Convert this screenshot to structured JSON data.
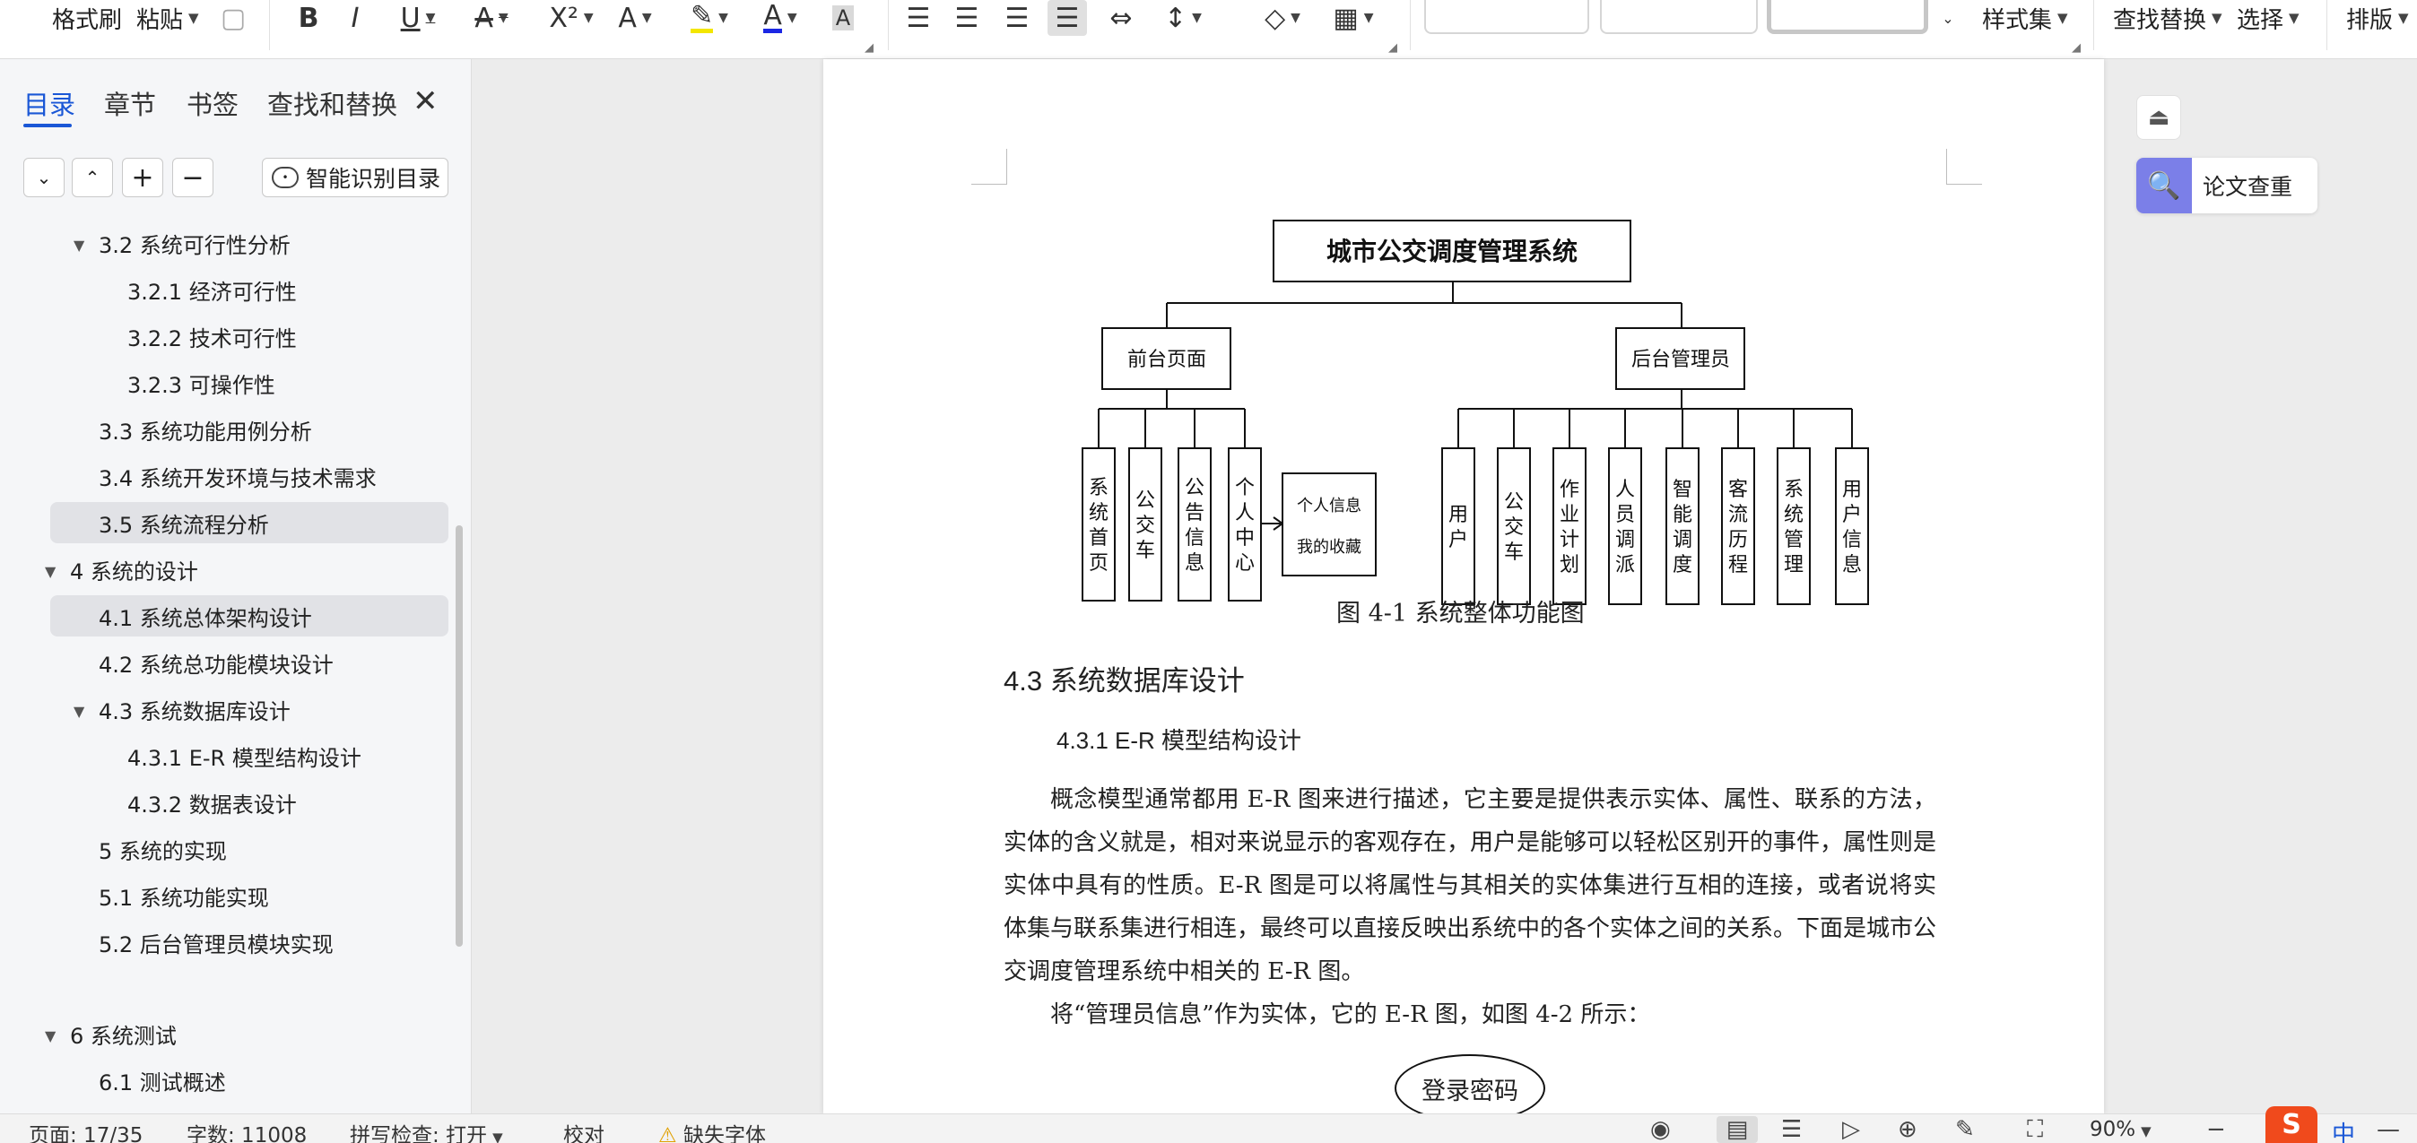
{
  "ribbon": {
    "format_painter": "格式刷",
    "paste": "粘贴",
    "style_set": "样式集",
    "find_replace": "查找替换",
    "select": "选择",
    "layout": "排版"
  },
  "nav": {
    "tabs": [
      "目录",
      "章节",
      "书签",
      "查找和替换"
    ],
    "smart_toc": "智能识别目录",
    "items": [
      {
        "label": "3.2  系统可行性分析"
      },
      {
        "label": "3.2.1 经济可行性"
      },
      {
        "label": "3.2.2 技术可行性"
      },
      {
        "label": "3.2.3 可操作性"
      },
      {
        "label": "3.3 系统功能用例分析"
      },
      {
        "label": "3.4 系统开发环境与技术需求"
      },
      {
        "label": "3.5 系统流程分析"
      },
      {
        "label": "4   系统的设计"
      },
      {
        "label": "4.1  系统总体架构设计"
      },
      {
        "label": "4.2  系统总功能模块设计"
      },
      {
        "label": "4.3 系统数据库设计"
      },
      {
        "label": "4.3.1 E-R 模型结构设计"
      },
      {
        "label": "4.3.2 数据表设计"
      },
      {
        "label": "5   系统的实现"
      },
      {
        "label": "5.1 系统功能实现"
      },
      {
        "label": "5.2 后台管理员模块实现"
      },
      {
        "label": "6 系统测试"
      },
      {
        "label": "6.1 测试概述"
      }
    ]
  },
  "diagram": {
    "root": "城市公交调度管理系统",
    "front": "前台页面",
    "back": "后台管理员",
    "front_children": [
      "系统首页",
      "公交车",
      "公告信息",
      "个人中心"
    ],
    "personal_box": [
      "个人信息",
      "我的收藏"
    ],
    "back_children": [
      "用户",
      "公交车",
      "作业计划",
      "人员调派",
      "智能调度",
      "客流历程",
      "系统管理",
      "用户信息"
    ]
  },
  "document": {
    "caption": "图 4-1  系统整体功能图",
    "heading_2": "4.3 系统数据库设计",
    "heading_3": "4.3.1  E-R 模型结构设计",
    "paragraph_1": "概念模型通常都用 E-R 图来进行描述，它主要是提供表示实体、属性、联系的方法，实体的含义就是，相对来说显示的客观存在，用户是能够可以轻松区别开的事件，属性则是实体中具有的性质。E-R 图是可以将属性与其相关的实体集进行互相的连接，或者说将实体集与联系集进行相连，最终可以直接反映出系统中的各个实体之间的关系。下面是城市公交调度管理系统中相关的 E-R 图。",
    "paragraph_2": "将“管理员信息”作为实体，它的 E-R 图，如图 4-2 所示：",
    "ellipse_label": "登录密码"
  },
  "side": {
    "paper_check": "论文查重"
  },
  "status": {
    "page": "页面: 17/35",
    "words": "字数: 11008",
    "spellcheck": "拼写检查: 打开",
    "proofread": "校对",
    "missing_font": "缺失字体",
    "zoom": "90%",
    "ime_lang": "中"
  },
  "colors": {
    "accent": "#1a57d6",
    "paper_check_icon": "#7b7fe8",
    "ime": "#f04a1c"
  }
}
